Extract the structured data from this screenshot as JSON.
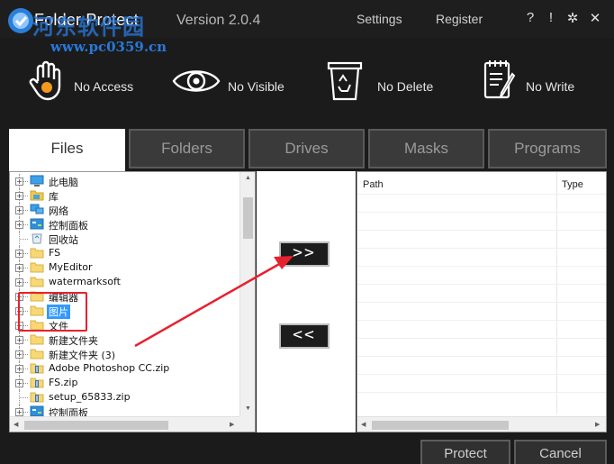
{
  "title_bar": {
    "title": "Folder Protect",
    "version": "Version 2.0.4",
    "settings_label": "Settings",
    "register_label": "Register",
    "help_label": "?",
    "info_label": "!",
    "minimize_label": "✲",
    "close_label": "✕"
  },
  "watermark": {
    "site_name": "河东软件园",
    "url": "www.pc0359.cn"
  },
  "modes": [
    {
      "label": "No Access",
      "icon": "hand-icon"
    },
    {
      "label": "No Visible",
      "icon": "eye-icon"
    },
    {
      "label": "No Delete",
      "icon": "recycle-bin-icon"
    },
    {
      "label": "No Write",
      "icon": "notepad-pen-icon"
    }
  ],
  "tabs": [
    {
      "label": "Files",
      "active": true
    },
    {
      "label": "Folders",
      "active": false
    },
    {
      "label": "Drives",
      "active": false
    },
    {
      "label": "Masks",
      "active": false
    },
    {
      "label": "Programs",
      "active": false
    }
  ],
  "tree": [
    {
      "label": "此电脑",
      "icon": "computer-icon",
      "expandable": true,
      "selected": false
    },
    {
      "label": "库",
      "icon": "library-folder-icon",
      "expandable": true,
      "selected": false
    },
    {
      "label": "网络",
      "icon": "network-icon",
      "expandable": true,
      "selected": false
    },
    {
      "label": "控制面板",
      "icon": "control-panel-icon",
      "expandable": true,
      "selected": false
    },
    {
      "label": "回收站",
      "icon": "recycle-bin-icon",
      "expandable": false,
      "selected": false
    },
    {
      "label": "FS",
      "icon": "folder-icon",
      "expandable": true,
      "selected": false
    },
    {
      "label": "MyEditor",
      "icon": "folder-icon",
      "expandable": true,
      "selected": false
    },
    {
      "label": "watermarksoft",
      "icon": "folder-icon",
      "expandable": true,
      "selected": false
    },
    {
      "label": "编辑器",
      "icon": "folder-icon",
      "expandable": true,
      "selected": false
    },
    {
      "label": "图片",
      "icon": "folder-icon",
      "expandable": true,
      "selected": true
    },
    {
      "label": "文件",
      "icon": "folder-icon",
      "expandable": true,
      "selected": false
    },
    {
      "label": "新建文件夹",
      "icon": "folder-icon",
      "expandable": true,
      "selected": false
    },
    {
      "label": "新建文件夹 (3)",
      "icon": "folder-icon",
      "expandable": true,
      "selected": false
    },
    {
      "label": "Adobe Photoshop CC.zip",
      "icon": "zip-icon",
      "expandable": true,
      "selected": false
    },
    {
      "label": "FS.zip",
      "icon": "zip-icon",
      "expandable": true,
      "selected": false
    },
    {
      "label": "setup_65833.zip",
      "icon": "zip-icon",
      "expandable": false,
      "selected": false
    },
    {
      "label": "控制面板",
      "icon": "control-panel-icon",
      "expandable": true,
      "selected": false
    }
  ],
  "transfer": {
    "add_label": ">>",
    "remove_label": "<<"
  },
  "grid": {
    "columns": [
      "Path",
      "Type"
    ]
  },
  "footer": {
    "protect_label": "Protect",
    "cancel_label": "Cancel"
  },
  "colors": {
    "accent_orange": "#f39a1e",
    "annotation_red": "#e8212e",
    "selection_blue": "#3399ff"
  }
}
